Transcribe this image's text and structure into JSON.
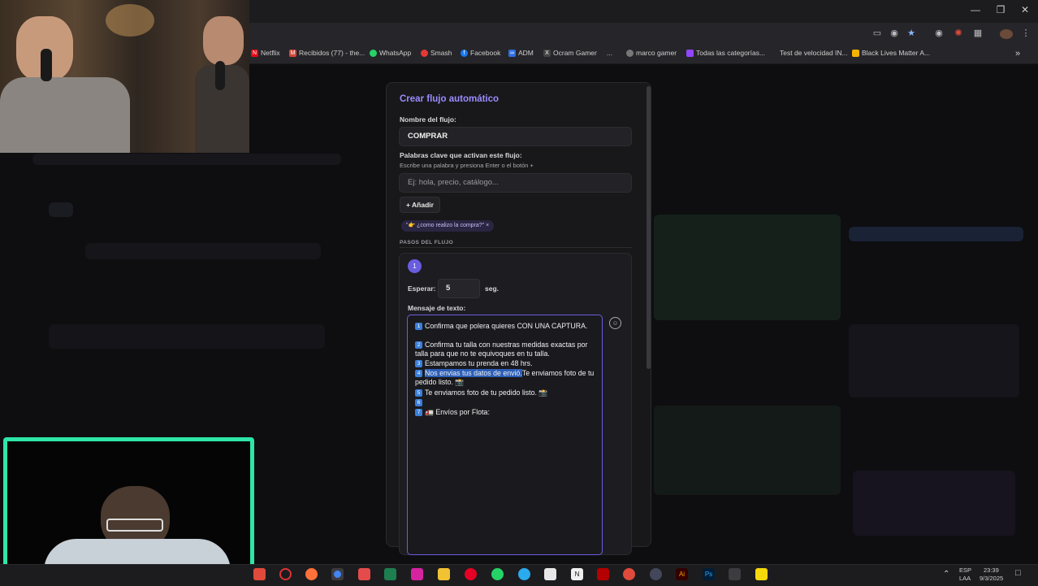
{
  "browser": {
    "bookmarks": [
      {
        "label": "Netflix",
        "icon": "netflix-icon",
        "color": "#e50914"
      },
      {
        "label": "Recibidos (77) - the...",
        "icon": "mail-icon",
        "color": "#d44638"
      },
      {
        "label": "WhatsApp",
        "icon": "whatsapp-icon",
        "color": "#25d366"
      },
      {
        "label": "Smash",
        "icon": "smash-icon",
        "color": "#e53935"
      },
      {
        "label": "Facebook",
        "icon": "facebook-icon",
        "color": "#1877f2"
      },
      {
        "label": "ADM",
        "icon": "meta-icon",
        "color": "#2f6fe0"
      },
      {
        "label": "Ocram Gamer",
        "icon": "x-icon",
        "color": "#444444"
      },
      {
        "label": "...",
        "icon": "",
        "color": ""
      },
      {
        "label": "marco gamer",
        "icon": "globe-icon",
        "color": "#777777"
      },
      {
        "label": "Todas las categorías...",
        "icon": "twitch-icon",
        "color": "#9146ff"
      },
      {
        "label": "Test de velocidad IN...",
        "icon": "",
        "color": ""
      },
      {
        "label": "Black Lives Matter A...",
        "icon": "bookmark-icon",
        "color": "#f5b400"
      }
    ],
    "more": "»"
  },
  "form": {
    "title": "Crear flujo automático",
    "name_label": "Nombre del flujo:",
    "name_value": "COMPRAR",
    "keywords_label": "Palabras clave que activan este flujo:",
    "keywords_hint": "Escribe una palabra y presiona Enter o el botón +",
    "keywords_placeholder": "Ej: hola, precio, catálogo...",
    "add_button": "+ Añadir",
    "keyword_chip": "\"👉 ¿como realizo la compra?\" ×",
    "steps_title": "PASOS DEL FLUJO"
  },
  "step": {
    "number": "1",
    "wait_label": "Esperar:",
    "wait_value": "5",
    "wait_unit": "seg.",
    "message_label": "Mensaje de texto:",
    "lines": [
      {
        "num": "1",
        "text": "Confirma que polera quieres CON UNA CAPTURA."
      },
      {
        "num": "2",
        "text": "Confirma tu talla con nuestras medidas exactas por talla para que no te equivoques en tu talla."
      },
      {
        "num": "3",
        "text": "Estampamos tu prenda en 48 hrs."
      },
      {
        "num": "4",
        "text_highlight": "Nos envias tus datos de envió.",
        "text": "Te enviamos foto de tu pedido listo. 📸"
      },
      {
        "num": "5",
        "text": "Te enviamos foto de tu pedido listo. 📸"
      },
      {
        "num": "6",
        "text": ""
      },
      {
        "num": "7",
        "text": "🚛 Envíos por Flota:"
      }
    ]
  },
  "tray": {
    "lang": "ESP",
    "region": "LAA",
    "time": "23:39",
    "date": "9/3/2025"
  }
}
